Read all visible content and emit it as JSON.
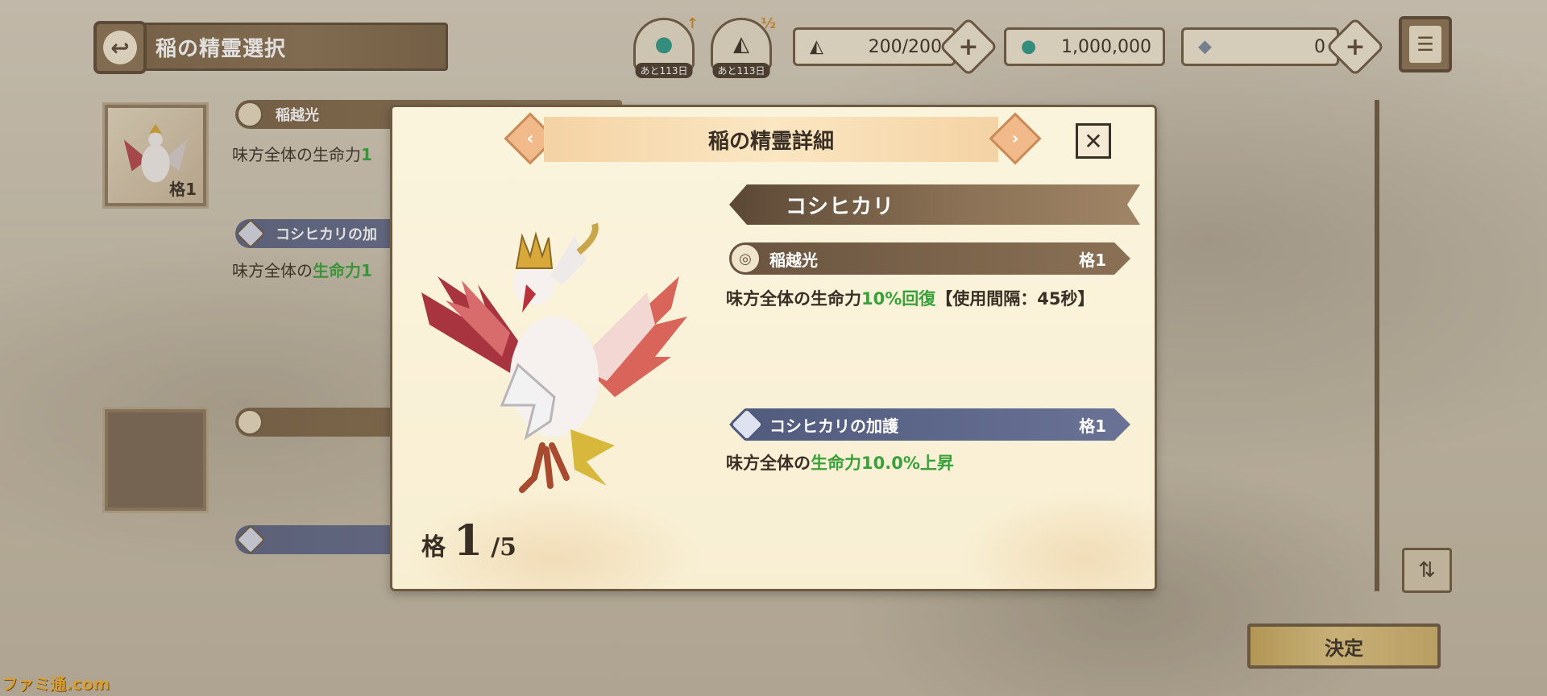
{
  "header": {
    "title": "稲の精霊選択"
  },
  "buffs": [
    {
      "icon": "spirit-drop-up-icon",
      "glyph": "●",
      "badge": "↑",
      "remaining": "あと113日"
    },
    {
      "icon": "onigiri-half-icon",
      "glyph": "◭",
      "badge": "½",
      "remaining": "あと113日"
    }
  ],
  "resources": {
    "stamina": "200/200",
    "spirit_drops": "1,000,000",
    "crystals": "0"
  },
  "list": {
    "item1": {
      "grade": "格1",
      "skill1_name": "稲越光",
      "skill1_desc_prefix": "味方全体の生命力",
      "skill1_desc_highlight": "1",
      "skill2_name": "コシヒカリの加",
      "skill2_desc_prefix": "味方全体の",
      "skill2_desc_highlight": "生命力1"
    }
  },
  "modal": {
    "title": "稲の精霊詳細",
    "spirit_name": "コシヒカリ",
    "grade_label": "格",
    "grade_current": "1",
    "grade_max": "/5",
    "skills": [
      {
        "name": "稲越光",
        "grade": "格1",
        "desc_prefix": "味方全体の生命力",
        "desc_highlight": "10%回復",
        "desc_suffix": "【使用間隔：45秒】"
      },
      {
        "name": "コシヒカリの加護",
        "grade": "格1",
        "desc_prefix": "味方全体の",
        "desc_highlight": "生命力10.0%上昇",
        "desc_suffix": ""
      }
    ]
  },
  "decide_label": "決定",
  "watermark": "ファミ通.com",
  "colors": {
    "highlight_green": "#3aa13a",
    "brown_bar": "#8a7155",
    "blue_bar": "#6a7396",
    "decide_gold": "#e0c683"
  }
}
